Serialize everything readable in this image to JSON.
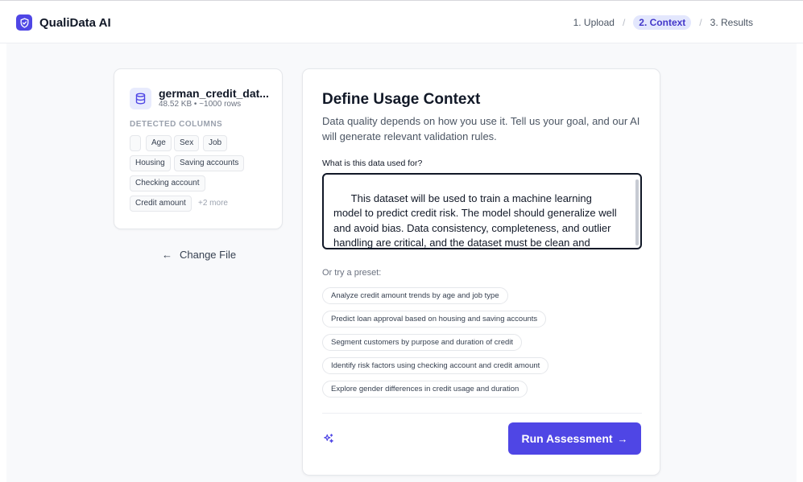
{
  "app": {
    "name": "QualiData AI",
    "accent": "#4f46e5"
  },
  "steps": [
    {
      "label": "1. Upload",
      "active": false
    },
    {
      "label": "2. Context",
      "active": true
    },
    {
      "label": "3. Results",
      "active": false
    }
  ],
  "step_separator": "/",
  "file": {
    "name": "german_credit_dat...",
    "meta": "48.52 KB • ~1000 rows",
    "columns_label": "DETECTED COLUMNS",
    "columns": [
      "",
      "Age",
      "Sex",
      "Job",
      "Housing",
      "Saving accounts",
      "Checking account",
      "Credit amount"
    ],
    "more": "+2 more",
    "icon": "database-icon"
  },
  "change_file": {
    "label": "Change File",
    "icon": "arrow-left-icon"
  },
  "context": {
    "title": "Define Usage Context",
    "description": "Data quality depends on how you use it. Tell us your goal, and our AI will generate relevant validation rules.",
    "field_label": "What is this data used for?",
    "text_value": "This dataset will be used to train a machine learning model to predict credit risk. The model should generalize well and avoid bias. Data consistency, completeness, and outlier handling are critical, and the dataset must be clean and balanced to avoid degrading model performance.",
    "preset_label": "Or try a preset:",
    "presets": [
      "Analyze credit amount trends by age and job type",
      "Predict loan approval based on housing and saving accounts",
      "Segment customers by purpose and duration of credit",
      "Identify risk factors using checking account and credit amount",
      "Explore gender differences in credit usage and duration"
    ],
    "run_label": "Run Assessment",
    "run_icon": "arrow-right-icon",
    "sparkle_icon": "sparkle-icon"
  }
}
